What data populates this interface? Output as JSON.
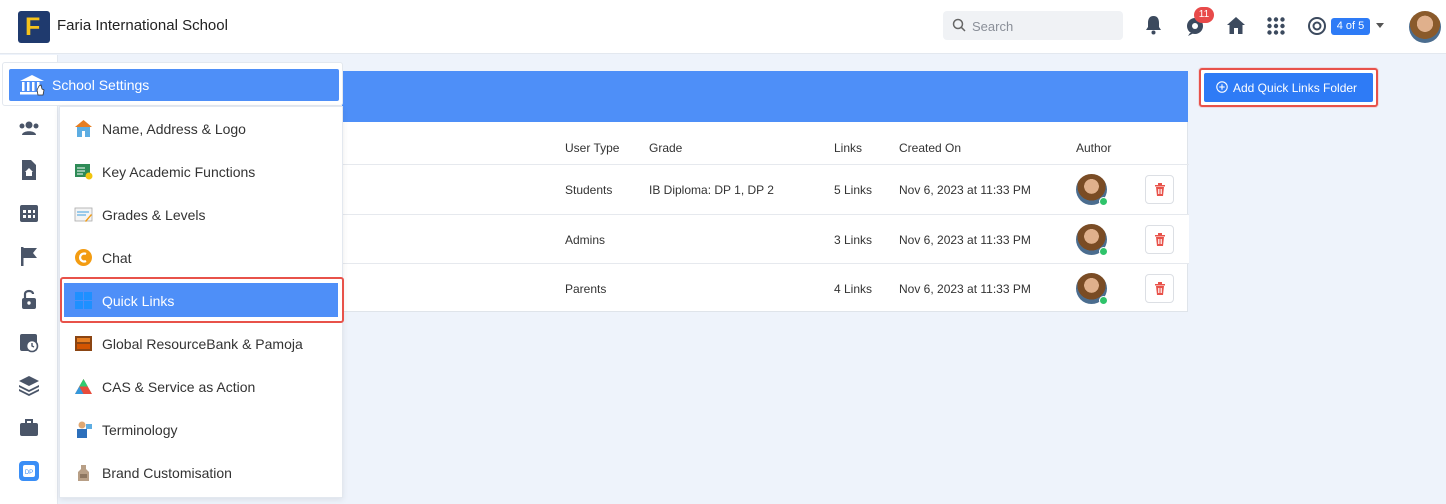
{
  "app": {
    "school_name": "Faria International School",
    "logo_letter": "F",
    "brand_color": "#1f3a6e",
    "accent": "#4e8ff8"
  },
  "topbar": {
    "search_placeholder": "Search",
    "notifications_badge": "11",
    "year_indicator": "4 of 5",
    "icons": [
      "search-icon",
      "bell-icon",
      "chat-icon",
      "home-icon",
      "apps-grid-icon",
      "lifebuoy-icon",
      "user-avatar"
    ]
  },
  "menu": {
    "header": "School Settings",
    "items": [
      {
        "label": "Name, Address & Logo",
        "icon": "school-house-icon"
      },
      {
        "label": "Key Academic Functions",
        "icon": "academic-functions-icon"
      },
      {
        "label": "Grades & Levels",
        "icon": "grades-icon"
      },
      {
        "label": "Chat",
        "icon": "chat-app-icon"
      },
      {
        "label": "Quick Links",
        "icon": "quick-links-icon",
        "active": true
      },
      {
        "label": "Global ResourceBank & Pamoja",
        "icon": "resource-bank-icon"
      },
      {
        "label": "CAS & Service as Action",
        "icon": "cas-icon"
      },
      {
        "label": "Terminology",
        "icon": "terminology-icon"
      },
      {
        "label": "Brand Customisation",
        "icon": "brand-icon"
      }
    ]
  },
  "actions": {
    "add_folder_label": "Add Quick Links Folder"
  },
  "table": {
    "headers": [
      "User Type",
      "Grade",
      "Links",
      "Created On",
      "Author"
    ],
    "rows": [
      {
        "user_type": "Students",
        "grade": "IB Diploma: DP 1, DP 2",
        "links": "5 Links",
        "created_on": "Nov 6, 2023 at 11:33 PM"
      },
      {
        "user_type": "Admins",
        "grade": "",
        "links": "3 Links",
        "created_on": "Nov 6, 2023 at 11:33 PM"
      },
      {
        "user_type": "Parents",
        "grade": "",
        "links": "4 Links",
        "created_on": "Nov 6, 2023 at 11:33 PM"
      }
    ]
  }
}
